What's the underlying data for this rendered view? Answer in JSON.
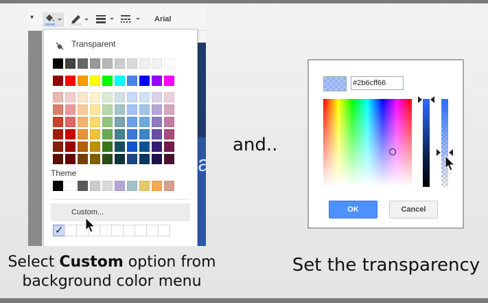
{
  "toolbar": {
    "font_label": "Arial"
  },
  "menu": {
    "transparent_label": "Transparent",
    "theme_label": "Theme",
    "custom_label": "Custom...",
    "grey_row": [
      "#000000",
      "#434343",
      "#666666",
      "#999999",
      "#b7b7b7",
      "#cccccc",
      "#d9d9d9",
      "#efefef",
      "#f3f3f3",
      "#ffffff"
    ],
    "bright_row": [
      "#980000",
      "#ff0000",
      "#ff9900",
      "#ffff00",
      "#00ff00",
      "#00ffff",
      "#4a86e8",
      "#0000ff",
      "#9900ff",
      "#ff00ff"
    ],
    "shades": [
      [
        "#e6b8af",
        "#f4cccc",
        "#fce5cd",
        "#fff2cc",
        "#d9ead3",
        "#d0e0e3",
        "#c9daf8",
        "#cfe2f3",
        "#d9d2e9",
        "#ead1dc"
      ],
      [
        "#dd7e6b",
        "#ea9999",
        "#f9cb9c",
        "#ffe599",
        "#b6d7a8",
        "#a2c4c9",
        "#a4c2f4",
        "#9fc5e8",
        "#b4a7d6",
        "#d5a6bd"
      ],
      [
        "#cc4125",
        "#e06666",
        "#f6b26b",
        "#ffd966",
        "#93c47d",
        "#76a5af",
        "#6d9eeb",
        "#6fa8dc",
        "#8e7cc3",
        "#c27ba0"
      ],
      [
        "#a61c00",
        "#cc0000",
        "#e69138",
        "#f1c232",
        "#6aa84f",
        "#45818e",
        "#3c78d8",
        "#3d85c6",
        "#674ea7",
        "#a64d79"
      ],
      [
        "#85200c",
        "#990000",
        "#b45f06",
        "#bf9000",
        "#38761d",
        "#134f5c",
        "#1155cc",
        "#0b5394",
        "#351c75",
        "#741b47"
      ],
      [
        "#5b0f00",
        "#660000",
        "#783f04",
        "#7f6000",
        "#274e13",
        "#0c343d",
        "#1c4587",
        "#073763",
        "#20124d",
        "#4c1130"
      ]
    ],
    "theme_row": [
      "#000000",
      "#ffffff",
      "#595959",
      "#cccccc",
      "#d9d9d9",
      "#b4a7d6",
      "#a2c4c9",
      "#e6c86e",
      "#f6a94a",
      "#d5a08e"
    ]
  },
  "captions": {
    "left_pre": "Select ",
    "left_bold": "Custom",
    "left_post": " option from",
    "left_line2": "background color menu",
    "middle": "and..",
    "right": "Set the transparency"
  },
  "dialog": {
    "hex_value": "#2b6cff66",
    "ok_label": "OK",
    "cancel_label": "Cancel"
  },
  "colors": {
    "accent": "#4d90fe",
    "selected_color": "#2b6cff"
  }
}
